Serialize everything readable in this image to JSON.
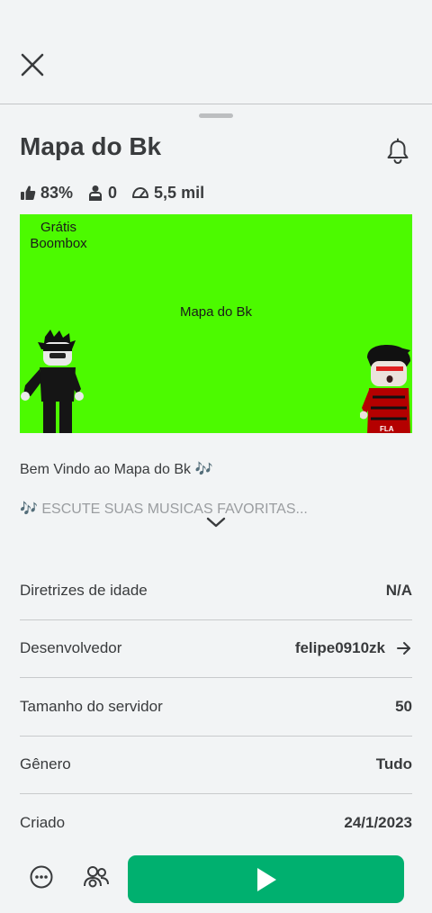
{
  "game": {
    "title": "Mapa do Bk",
    "stats": {
      "rating": "83%",
      "players": "0",
      "visits": "5,5 mil"
    }
  },
  "thumbnail": {
    "label_top": "Grátis\nBoombox",
    "label_center": "Mapa do Bk",
    "background": "#4cfa00"
  },
  "description": {
    "line1": "Bem Vindo ao Mapa do Bk 🎶",
    "line2": "🎶 ESCUTE SUAS MUSICAS FAVORITAS..."
  },
  "info": [
    {
      "label": "Diretrizes de idade",
      "value": "N/A"
    },
    {
      "label": "Desenvolvedor",
      "value": "felipe0910zk"
    },
    {
      "label": "Tamanho do servidor",
      "value": "50"
    },
    {
      "label": "Gênero",
      "value": "Tudo"
    },
    {
      "label": "Criado",
      "value": "24/1/2023"
    }
  ],
  "colors": {
    "play_button": "#00b06f",
    "text": "#393b3d"
  },
  "icons": {
    "close": "close-icon",
    "bell": "bell-icon",
    "thumbs_up": "thumbs-up-icon",
    "players": "players-icon",
    "visits": "visits-icon",
    "expand": "chevron-down-icon",
    "developer_link": "arrow-right-icon",
    "more": "more-icon",
    "party": "party-icon",
    "play": "play-icon"
  }
}
